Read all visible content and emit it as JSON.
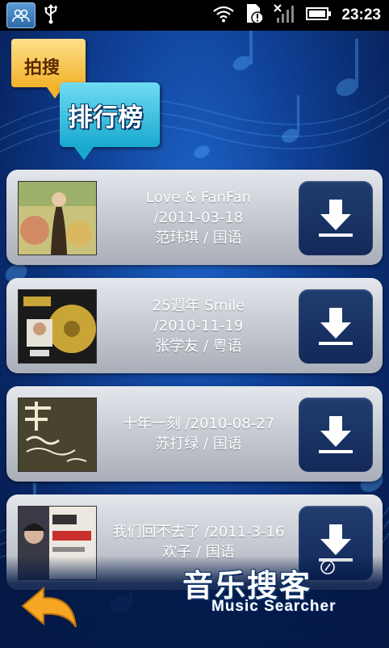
{
  "status_bar": {
    "time": "23:23",
    "icons": [
      "contacts-icon",
      "usb-icon",
      "wifi-icon",
      "sim-icon",
      "signal-icon",
      "battery-icon"
    ]
  },
  "logo": {
    "top_label": "拍搜",
    "main_label": "排行榜"
  },
  "albums": [
    {
      "title_line": "Love & FanFan",
      "date_line": "/2011-03-18",
      "artist_line": "范玮琪 / 国语",
      "cover": "album-cover-love-fanfan"
    },
    {
      "title_line": "25週年 Smile",
      "date_line": "/2010-11-19",
      "artist_line": "张学友 / 粤语",
      "cover": "album-cover-25-smile"
    },
    {
      "title_line": "十年一刻 /2010-08-27",
      "date_line": "",
      "artist_line": "苏打绿 / 国语",
      "cover": "album-cover-ten-years"
    },
    {
      "title_line": "我们回不去了 /2011-3-16",
      "date_line": "",
      "artist_line": "欢子 / 国语",
      "cover": "album-cover-huanzi"
    }
  ],
  "footer": {
    "app_name": "音乐搜客",
    "app_name_en": "Music Searcher"
  },
  "colors": {
    "background": "#0f3f94",
    "card": "#c3c7cf",
    "download_button": "#1b3466",
    "logo_orange": "#f3b22c",
    "logo_cyan": "#19a9cf",
    "back_arrow": "#f5a623"
  }
}
